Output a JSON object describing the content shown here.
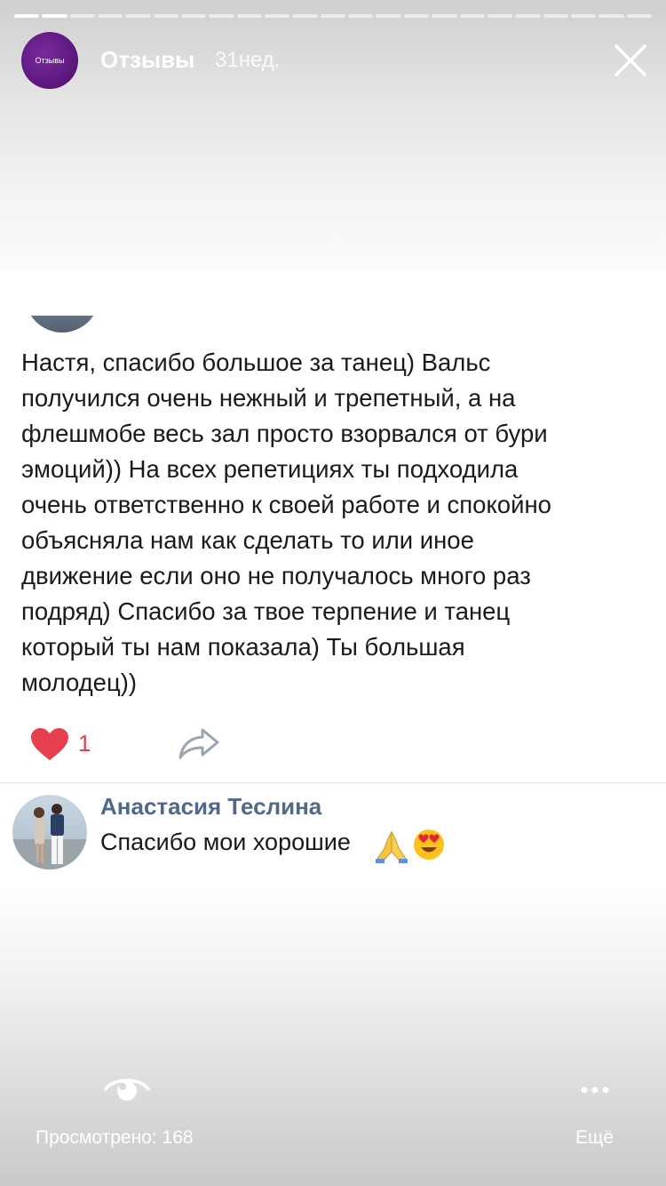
{
  "story": {
    "title": "Отзывы",
    "time": "31нед.",
    "avatar_label": "Отзывы",
    "progress": {
      "total": 23,
      "current": 2
    }
  },
  "post": {
    "lines": [
      "Настя, спасибо большое за танец) Вальс",
      "получился очень нежный и трепетный, а на",
      "флешмобе весь зал просто взорвался от бури",
      "эмоций)) На всех репетициях ты подходила",
      "очень ответственно к своей работе и спокойно",
      "объясняла нам как сделать то или иное",
      "движение если оно не получалось много раз",
      "подряд) Спасибо за твое терпение и танец",
      "который ты нам показала) Ты большая",
      "молодец))"
    ],
    "likes": "1",
    "like_color": "#e6404f"
  },
  "comment": {
    "author": "Анастасия Теслина",
    "text": "Спасибо мои хорошие",
    "author_color": "#50698b"
  },
  "footer": {
    "views": "Просмотрено: 168",
    "more": "Ещё"
  },
  "icons": [
    "close-icon",
    "heart-icon",
    "share-icon",
    "pray-emoji",
    "heart-eyes-emoji",
    "eye-icon",
    "more-dots-icon"
  ]
}
